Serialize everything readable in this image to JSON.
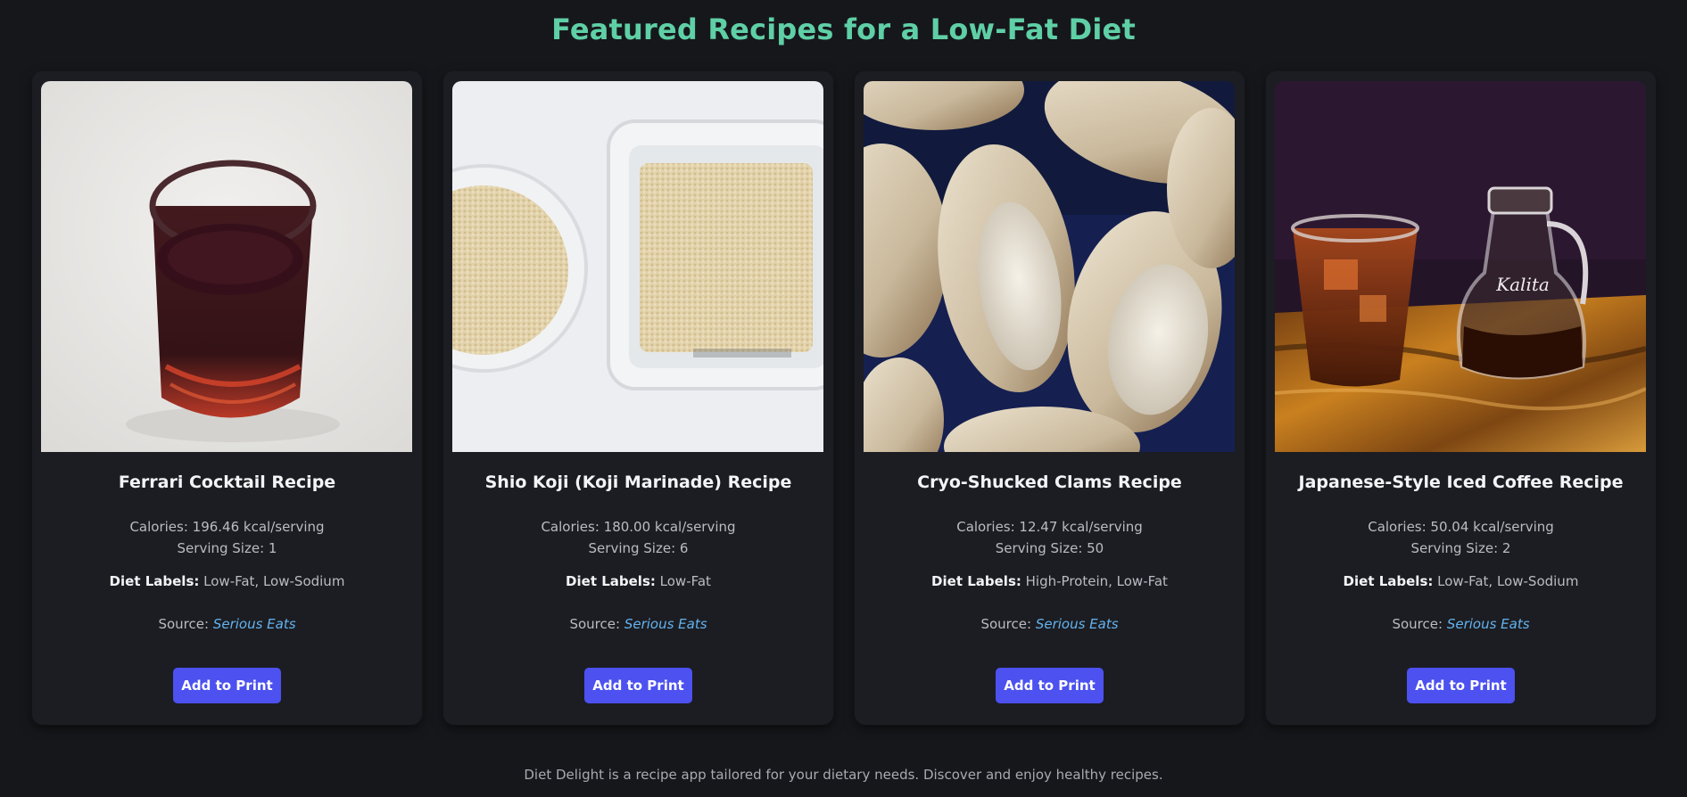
{
  "page": {
    "title": "Featured Recipes for a Low-Fat Diet",
    "footer": "Diet Delight is a recipe app tailored for your dietary needs. Discover and enjoy healthy recipes."
  },
  "colors": {
    "background": "#16171b",
    "card": "#1c1d22",
    "title_accent": "#5fcfa6",
    "button": "#4c51f0",
    "link": "#63b3f0"
  },
  "recipes": [
    {
      "title": "Ferrari Cocktail Recipe",
      "calories": "Calories: 196.46 kcal/serving",
      "serving": "Serving Size: 1",
      "diet_labels_label": "Diet Labels:",
      "diet_labels": "Low-Fat, Low-Sodium",
      "source_label": "Source:",
      "source": "Serious Eats",
      "button": "Add to Print",
      "image": "dark red cocktail in a glass"
    },
    {
      "title": "Shio Koji (Koji Marinade) Recipe",
      "calories": "Calories: 180.00 kcal/serving",
      "serving": "Serving Size: 6",
      "diet_labels_label": "Diet Labels:",
      "diet_labels": "Low-Fat",
      "source_label": "Source:",
      "source": "Serious Eats",
      "button": "Add to Print",
      "image": "koji rice in containers"
    },
    {
      "title": "Cryo-Shucked Clams Recipe",
      "calories": "Calories: 12.47 kcal/serving",
      "serving": "Serving Size: 50",
      "diet_labels_label": "Diet Labels:",
      "diet_labels": "High-Protein, Low-Fat",
      "source_label": "Source:",
      "source": "Serious Eats",
      "button": "Add to Print",
      "image": "open clams on blue background"
    },
    {
      "title": "Japanese-Style Iced Coffee Recipe",
      "calories": "Calories: 50.04 kcal/serving",
      "serving": "Serving Size: 2",
      "diet_labels_label": "Diet Labels:",
      "diet_labels": "Low-Fat, Low-Sodium",
      "source_label": "Source:",
      "source": "Serious Eats",
      "button": "Add to Print",
      "image": "iced coffee glass and carafe",
      "carafe_brand": "Kalita"
    }
  ]
}
